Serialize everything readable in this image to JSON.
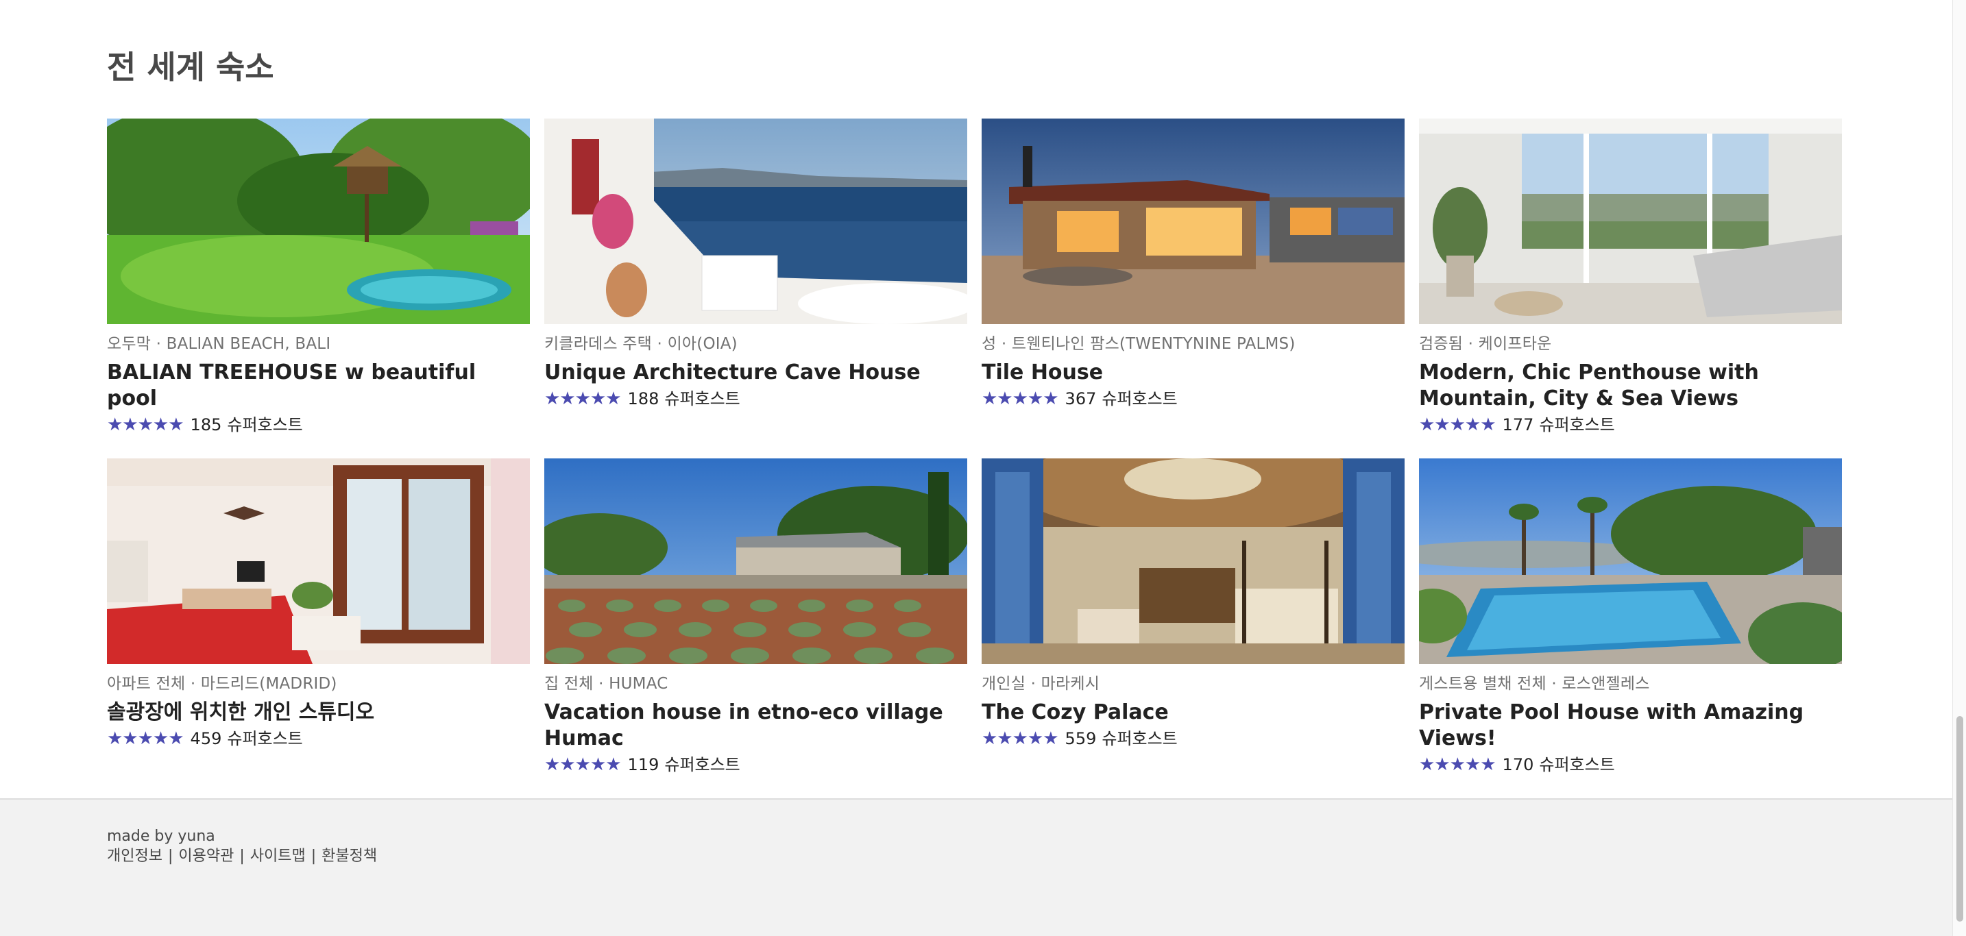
{
  "section": {
    "title": "전 세계 숙소"
  },
  "listings": [
    {
      "kind": "오두막 · BALIAN BEACH, BALI",
      "name": "BALIAN TREEHOUSE w beautiful pool",
      "stars": "★★★★★",
      "reviews": "185",
      "badge": "슈퍼호스트",
      "photo": "treehouse-photo"
    },
    {
      "kind": "키클라데스 주택 · 이아(OIA)",
      "name": "Unique Architecture Cave House",
      "stars": "★★★★★",
      "reviews": "188",
      "badge": "슈퍼호스트",
      "photo": "cave-house-photo"
    },
    {
      "kind": "성 · 트웬티나인 팜스(TWENTYNINE PALMS)",
      "name": "Tile House",
      "stars": "★★★★★",
      "reviews": "367",
      "badge": "슈퍼호스트",
      "photo": "tile-house-photo"
    },
    {
      "kind": "검증됨 · 케이프타운",
      "name": "Modern, Chic Penthouse with Mountain, City & Sea Views",
      "stars": "★★★★★",
      "reviews": "177",
      "badge": "슈퍼호스트",
      "photo": "penthouse-photo"
    },
    {
      "kind": "아파트 전체 · 마드리드(MADRID)",
      "name": "솔광장에 위치한 개인 스튜디오",
      "stars": "★★★★★",
      "reviews": "459",
      "badge": "슈퍼호스트",
      "photo": "studio-photo"
    },
    {
      "kind": "집 전체 · HUMAC",
      "name": "Vacation house in etno-eco village Humac",
      "stars": "★★★★★",
      "reviews": "119",
      "badge": "슈퍼호스트",
      "photo": "vacation-house-photo"
    },
    {
      "kind": "개인실 · 마라케시",
      "name": "The Cozy Palace",
      "stars": "★★★★★",
      "reviews": "559",
      "badge": "슈퍼호스트",
      "photo": "cozy-palace-photo"
    },
    {
      "kind": "게스트용 별채 전체 · 로스앤젤레스",
      "name": "Private Pool House with Amazing Views!",
      "stars": "★★★★★",
      "reviews": "170",
      "badge": "슈퍼호스트",
      "photo": "pool-house-photo"
    }
  ],
  "footer": {
    "made_by": "made by yuna",
    "links": [
      "개인정보",
      "이용약관",
      "사이트맵",
      "환불정책"
    ],
    "separator": "|"
  },
  "colors": {
    "star": "#4b4bb0",
    "footer_bg": "#f2f2f2"
  }
}
